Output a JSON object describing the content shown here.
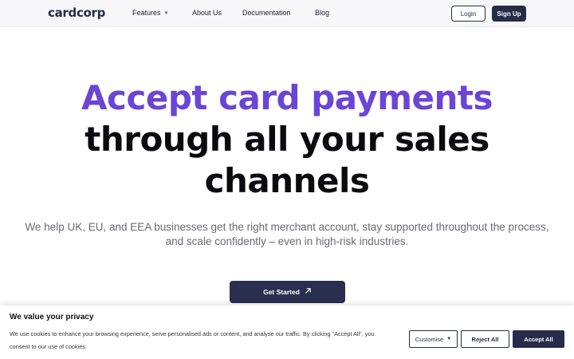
{
  "nav": {
    "logo": "cardcorp",
    "items": [
      {
        "label": "Features",
        "has_dropdown": true
      },
      {
        "label": "About Us"
      },
      {
        "label": "Documentation"
      },
      {
        "label": "Blog"
      }
    ],
    "login_label": "Login",
    "signup_label": "Sign Up"
  },
  "hero": {
    "title_accent": "Accept card payments",
    "title_line2": "through all your sales",
    "title_line3": "channels",
    "subtitle_line1": "We help UK, EU, and EEA businesses get the right merchant account, stay supported throughout the process,",
    "subtitle_line2": "and scale confidently – even in high-risk industries.",
    "cta_label": "Get Started",
    "cta_icon": "arrow-up-right-icon"
  },
  "cookie": {
    "title": "We value your privacy",
    "text_line1": "We use cookies to enhance your browsing experience, serve personalised ads or content, and analyse our traffic. By clicking \"Accept All\", you",
    "text_line2": "consent to our use of cookies.",
    "customise_label": "Customise",
    "reject_label": "Reject All",
    "accept_label": "Accept All"
  },
  "colors": {
    "brand_dark": "#262b4a",
    "accent_purple": "#6a45d6",
    "subtext_gray": "#6a6a72"
  }
}
